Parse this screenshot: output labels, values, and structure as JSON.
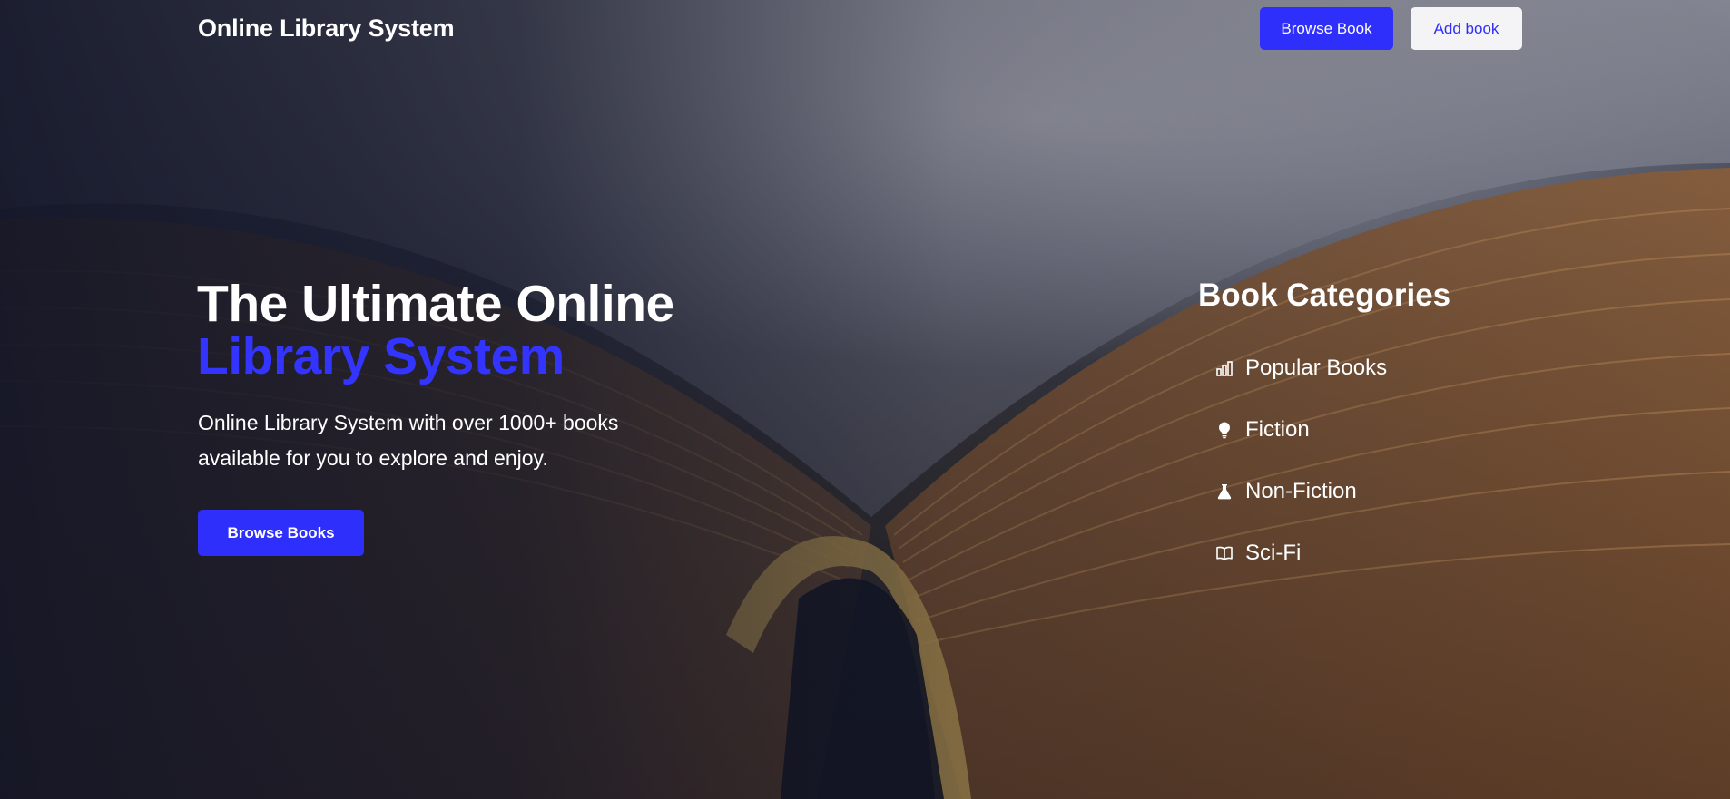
{
  "header": {
    "brand": "Online Library System",
    "nav_primary_label": "Browse Book",
    "nav_secondary_label": "Add book"
  },
  "hero": {
    "title_line1": "The Ultimate Online",
    "title_line2": "Library System",
    "description": "Online Library System with over 1000+ books available for you to explore and enjoy.",
    "cta_label": "Browse Books"
  },
  "categories": {
    "title": "Book Categories",
    "items": [
      {
        "label": "Popular Books",
        "icon": "bar-chart-icon"
      },
      {
        "label": "Fiction",
        "icon": "lightbulb-icon"
      },
      {
        "label": "Non-Fiction",
        "icon": "flask-icon"
      },
      {
        "label": "Sci-Fi",
        "icon": "open-book-icon"
      }
    ]
  },
  "colors": {
    "accent": "#2f2ffb",
    "title_accent": "#3434ff",
    "text": "#ffffff",
    "secondary_button_bg": "#f4f4f6"
  }
}
